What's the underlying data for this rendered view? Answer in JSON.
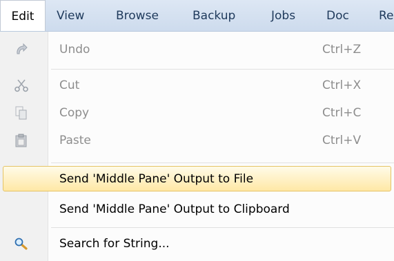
{
  "menubar": {
    "items": [
      {
        "label": "Edit",
        "active": true
      },
      {
        "label": "View"
      },
      {
        "label": "Browse"
      },
      {
        "label": "Backup"
      },
      {
        "label": "Jobs"
      },
      {
        "label": "Doc"
      },
      {
        "label": "Re"
      }
    ]
  },
  "menu": {
    "items": [
      {
        "label": "Undo",
        "shortcut": "Ctrl+Z",
        "icon": "undo-icon",
        "enabled": false
      },
      {
        "label": "Cut",
        "shortcut": "Ctrl+X",
        "icon": "scissors-icon",
        "enabled": false
      },
      {
        "label": "Copy",
        "shortcut": "Ctrl+C",
        "icon": "copy-icon",
        "enabled": false
      },
      {
        "label": "Paste",
        "shortcut": "Ctrl+V",
        "icon": "paste-icon",
        "enabled": false
      },
      {
        "label": "Send 'Middle Pane' Output to File",
        "shortcut": "",
        "enabled": true,
        "highlighted": true
      },
      {
        "label": "Send 'Middle Pane' Output to Clipboard",
        "shortcut": "",
        "enabled": true
      },
      {
        "label": "Search for String...",
        "shortcut": "",
        "icon": "magnifier-icon",
        "enabled": true
      }
    ]
  },
  "colors": {
    "highlight_border": "#e5c365",
    "highlight_fill": "#ffe8a6",
    "menubar_text": "#1e395b",
    "disabled_text": "#8d8d8d"
  }
}
